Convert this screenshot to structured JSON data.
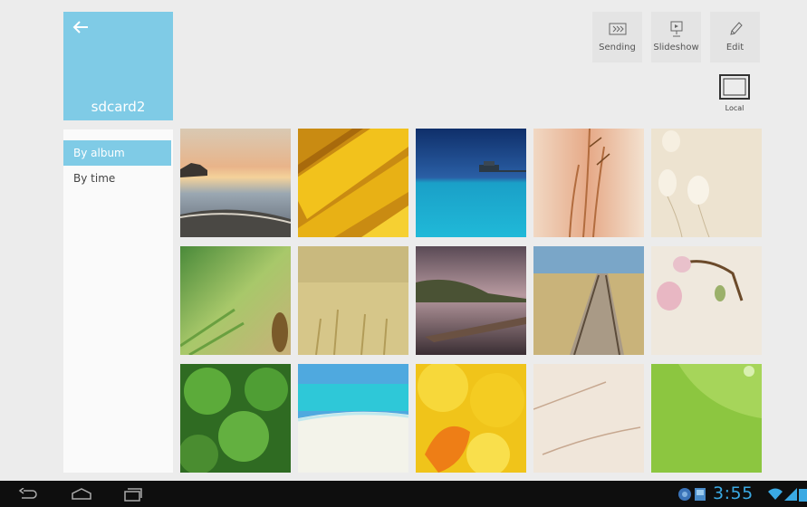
{
  "album": {
    "name": "sdcard2"
  },
  "nav": {
    "items": [
      {
        "label": "By album",
        "active": true
      },
      {
        "label": "By time",
        "active": false
      }
    ]
  },
  "toolbar": {
    "sending_label": "Sending",
    "slideshow_label": "Slideshow",
    "edit_label": "Edit",
    "local_label": "Local"
  },
  "photos": [
    {
      "subject": "seaside sunset"
    },
    {
      "subject": "sunflower petals"
    },
    {
      "subject": "pier over blue sea"
    },
    {
      "subject": "golden grass stalks"
    },
    {
      "subject": "cotton grass"
    },
    {
      "subject": "green grass bokeh"
    },
    {
      "subject": "wheat field"
    },
    {
      "subject": "lake at dusk"
    },
    {
      "subject": "boardwalk through dunes"
    },
    {
      "subject": "pink blossoms"
    },
    {
      "subject": "clover leaves"
    },
    {
      "subject": "tropical beach"
    },
    {
      "subject": "yellow leaves"
    },
    {
      "subject": "beige grass closeup"
    },
    {
      "subject": "green leaf with dew"
    }
  ],
  "status": {
    "clock": "3:55"
  },
  "colors": {
    "accent": "#7fcbe6",
    "clock": "#3aa9e3",
    "sysbar": "#0e0e0e"
  }
}
